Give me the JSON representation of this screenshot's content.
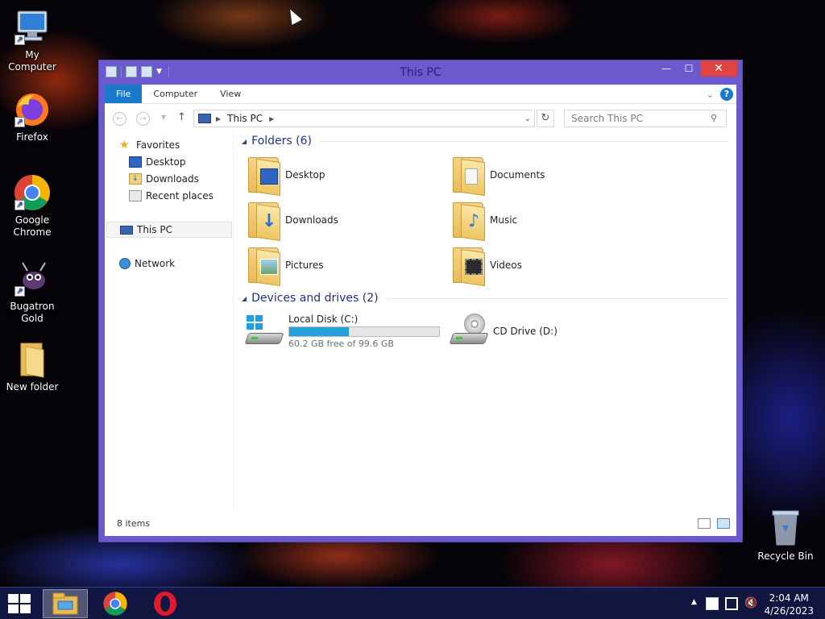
{
  "desktop": {
    "icons": [
      {
        "label": "My Computer",
        "icon": "computer-icon"
      },
      {
        "label": "Firefox",
        "icon": "firefox-icon"
      },
      {
        "label": "Google Chrome",
        "icon": "chrome-icon"
      },
      {
        "label": "Bugatron Gold",
        "icon": "bug-game-icon"
      },
      {
        "label": "New folder",
        "icon": "folder-icon"
      },
      {
        "label": "Recycle Bin",
        "icon": "recycle-bin-icon"
      }
    ]
  },
  "window": {
    "title": "This PC",
    "ribbon": {
      "tabs": [
        "File",
        "Computer",
        "View"
      ]
    },
    "address": {
      "crumb": "This PC"
    },
    "search": {
      "placeholder": "Search This PC"
    },
    "sidebar": {
      "favorites": "Favorites",
      "items": [
        "Desktop",
        "Downloads",
        "Recent places"
      ],
      "this_pc": "This PC",
      "network": "Network"
    },
    "folders_group": "Folders (6)",
    "folders": [
      {
        "label": "Desktop",
        "icon": "desktop-folder-icon"
      },
      {
        "label": "Documents",
        "icon": "documents-folder-icon"
      },
      {
        "label": "Downloads",
        "icon": "downloads-folder-icon"
      },
      {
        "label": "Music",
        "icon": "music-folder-icon"
      },
      {
        "label": "Pictures",
        "icon": "pictures-folder-icon"
      },
      {
        "label": "Videos",
        "icon": "videos-folder-icon"
      }
    ],
    "devices_group": "Devices and drives (2)",
    "drives": [
      {
        "label": "Local Disk (C:)",
        "free_text": "60.2 GB free of 99.6 GB",
        "used_fraction": 0.396
      },
      {
        "label": "CD Drive (D:)"
      }
    ],
    "status": {
      "count": "8 items"
    }
  },
  "taskbar": {
    "apps": [
      "file-explorer",
      "chrome",
      "opera"
    ],
    "clock": {
      "time": "2:04 AM",
      "date": "4/26/2023"
    }
  },
  "colors": {
    "window_frame": "#6a5acd",
    "file_tab": "#1979ca",
    "group_header": "#1e3287",
    "disk_bar": "#26a0da",
    "close_button": "#e04343"
  }
}
